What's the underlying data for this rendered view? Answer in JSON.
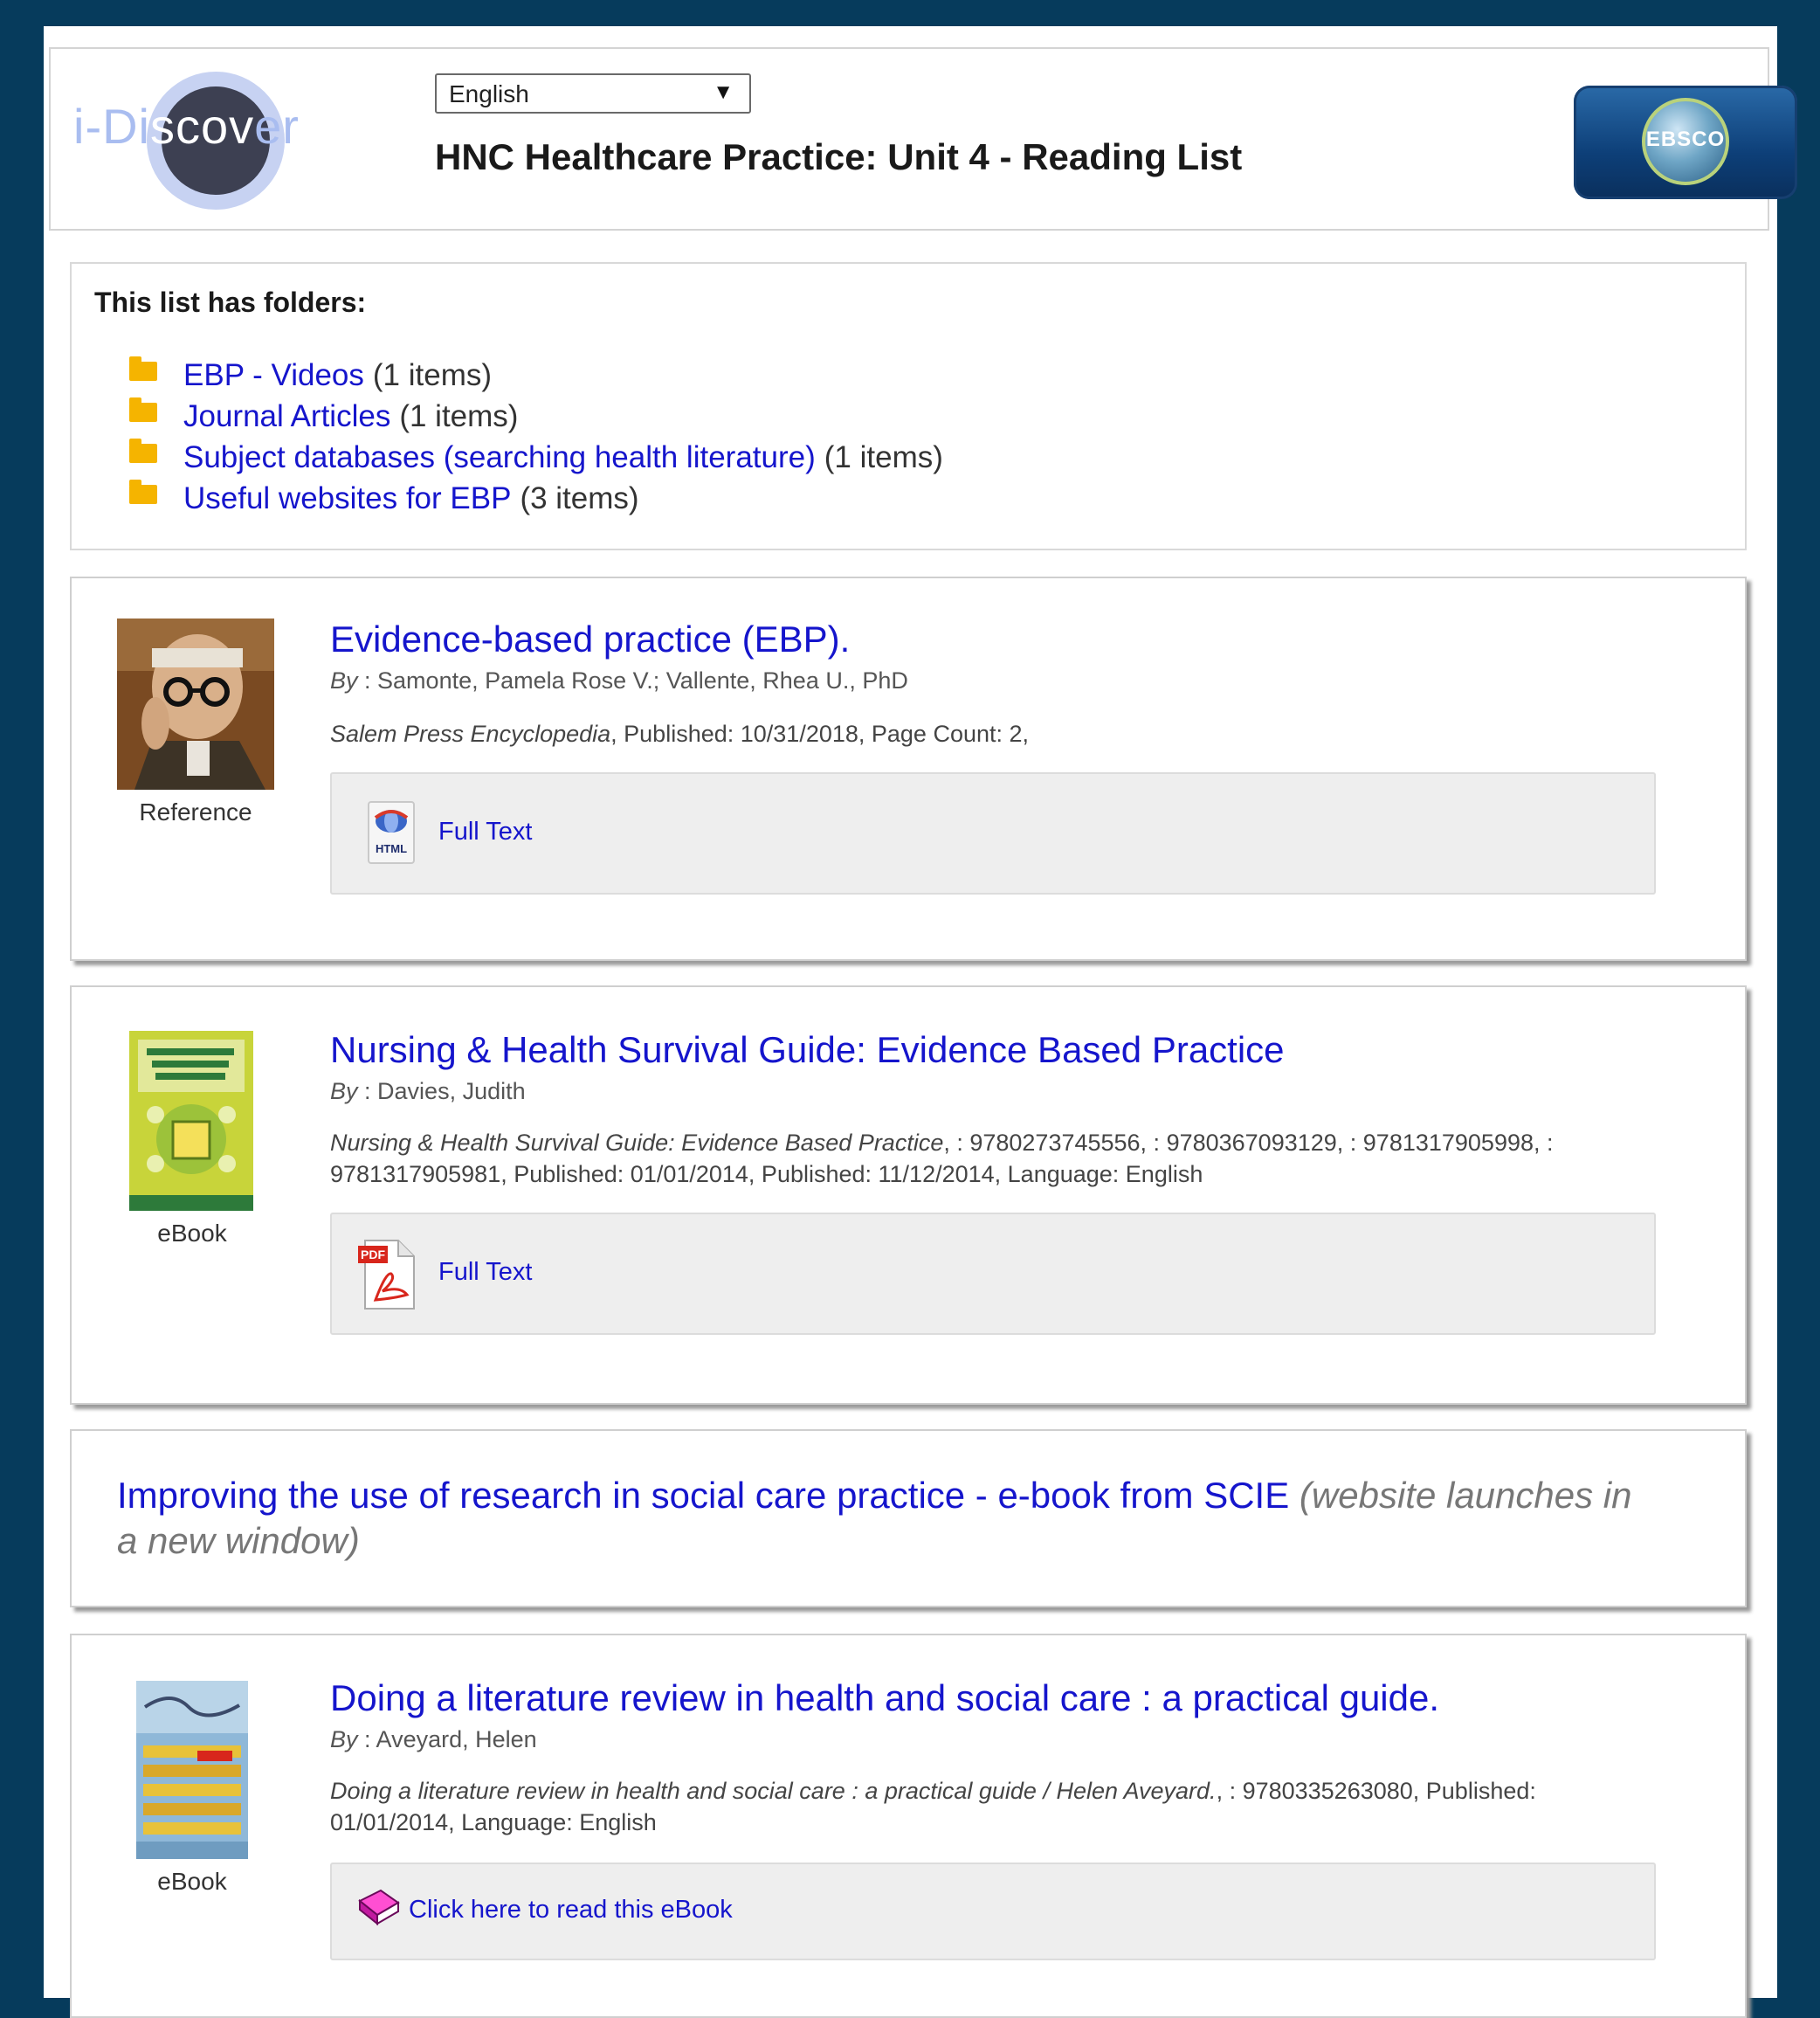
{
  "header": {
    "logo_text_left": "i-Di",
    "logo_text_mid": "scov",
    "logo_text_right": "er",
    "language_selected": "English",
    "title": "HNC Healthcare Practice: Unit 4 - Reading List",
    "ebsco_logo_text": "EBSCO"
  },
  "folders": {
    "heading": "This list has folders:",
    "items": [
      {
        "label": "EBP - Videos",
        "count": "(1 items)"
      },
      {
        "label": "Journal Articles",
        "count": "(1 items)"
      },
      {
        "label": "Subject databases (searching health literature)",
        "count": "(1 items)"
      },
      {
        "label": "Useful websites for EBP",
        "count": "(3 items)"
      }
    ]
  },
  "items": [
    {
      "type_label": "Reference",
      "title": "Evidence-based practice (EBP).",
      "by_label": "By",
      "by_value": ": Samonte, Pamela Rose V.; Vallente, Rhea U., PhD",
      "source": "Salem Press Encyclopedia",
      "meta": ", Published: 10/31/2018, Page Count: 2,",
      "link_label": "Full Text",
      "link_icon": "html-icon",
      "link_icon_text": "HTML"
    },
    {
      "type_label": "eBook",
      "title": "Nursing & Health Survival Guide: Evidence Based Practice",
      "by_label": "By",
      "by_value": ": Davies, Judith",
      "source": "Nursing & Health Survival Guide: Evidence Based Practice",
      "meta": ", : 9780273745556, : 9780367093129, : 9781317905998, : 9781317905981, Published: 01/01/2014, Published: 11/12/2014, Language: English",
      "link_label": "Full Text",
      "link_icon": "pdf-icon",
      "link_icon_text": "PDF"
    },
    {
      "type_label": "eBook",
      "title": "Doing a literature review in health and social care : a practical guide.",
      "by_label": "By",
      "by_value": ": Aveyard, Helen",
      "source": "Doing a literature review in health and social care : a practical guide / Helen Aveyard.",
      "meta": ", : 9780335263080, Published: 01/01/2014, Language: English",
      "link_label": "Click here to read this eBook",
      "link_icon": "book-icon"
    }
  ],
  "web_link": {
    "label": "Improving the use of research in social care practice - e-book from SCIE",
    "note": "(website launches in a new window)"
  },
  "colors": {
    "background": "#063b5c",
    "link": "#1515cc",
    "folder": "#f5b400"
  }
}
